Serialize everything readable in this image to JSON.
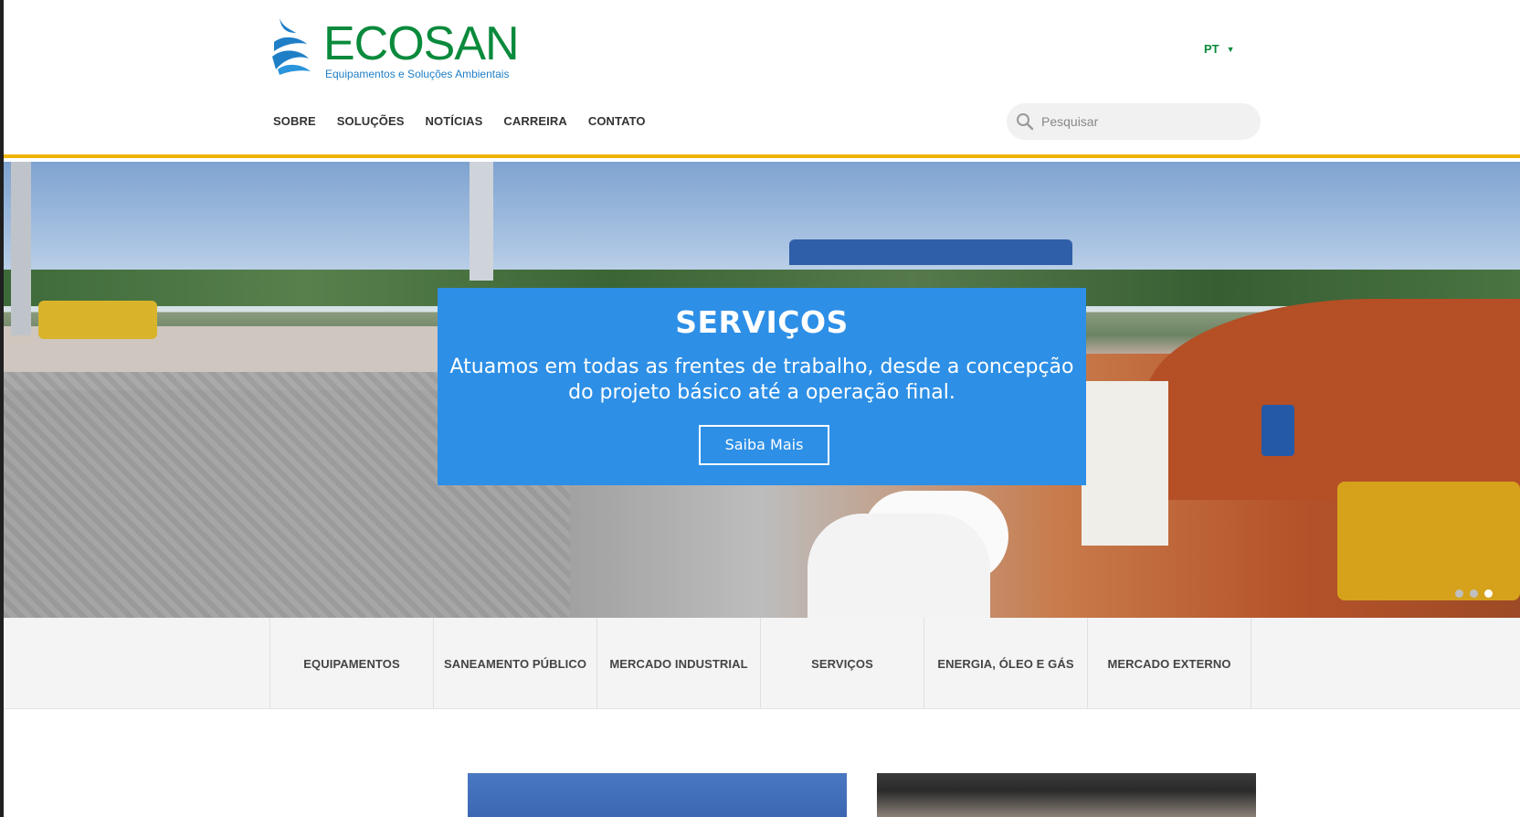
{
  "brand": {
    "name": "ECOSAN",
    "tagline": "Equipamentos e Soluções Ambientais",
    "green": "#0a8a3c",
    "blue": "#1f7fc6",
    "accent_yellow": "#f0b400"
  },
  "header": {
    "language": "PT",
    "nav": [
      "SOBRE",
      "SOLUÇÕES",
      "NOTÍCIAS",
      "CARREIRA",
      "CONTATO"
    ],
    "search": {
      "placeholder": "Pesquisar",
      "value": ""
    }
  },
  "hero": {
    "title": "SERVIÇOS",
    "text": "Atuamos em todas as frentes de trabalho, desde a concepção do projeto básico até a operação final.",
    "button": "Saiba Mais",
    "caption_color": "#2d8fe6",
    "slides": 3,
    "active_slide": 3
  },
  "categories": [
    "EQUIPAMENTOS",
    "SANEAMENTO PÚBLICO",
    "MERCADO INDUSTRIAL",
    "SERVIÇOS",
    "ENERGIA, ÓLEO E GÁS",
    "MERCADO EXTERNO"
  ]
}
